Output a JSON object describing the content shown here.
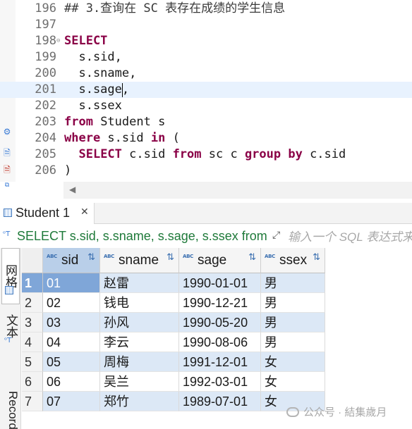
{
  "editor": {
    "lines": [
      {
        "num": "196",
        "parts": [
          {
            "t": "## 3.查询在 SC 表存在成绩的学生信息",
            "c": "cm"
          }
        ]
      },
      {
        "num": "197",
        "parts": []
      },
      {
        "num": "198",
        "fold": "⊖",
        "parts": [
          {
            "t": "SELECT",
            "c": "kw"
          }
        ]
      },
      {
        "num": "199",
        "parts": [
          {
            "t": "  s.sid,",
            "c": ""
          }
        ]
      },
      {
        "num": "200",
        "parts": [
          {
            "t": "  s.sname,",
            "c": ""
          }
        ]
      },
      {
        "num": "201",
        "current": true,
        "parts": [
          {
            "t": "  s.sage,",
            "c": ""
          }
        ]
      },
      {
        "num": "202",
        "parts": [
          {
            "t": "  s.ssex",
            "c": ""
          }
        ]
      },
      {
        "num": "203",
        "parts": [
          {
            "t": "from",
            "c": "kw"
          },
          {
            "t": " Student s",
            "c": ""
          }
        ]
      },
      {
        "num": "204",
        "parts": [
          {
            "t": "where",
            "c": "kw"
          },
          {
            "t": " s.sid ",
            "c": ""
          },
          {
            "t": "in",
            "c": "kw"
          },
          {
            "t": " (",
            "c": ""
          }
        ]
      },
      {
        "num": "205",
        "parts": [
          {
            "t": "  ",
            "c": ""
          },
          {
            "t": "SELECT",
            "c": "kw"
          },
          {
            "t": " c.sid ",
            "c": ""
          },
          {
            "t": "from",
            "c": "kw"
          },
          {
            "t": " sc c ",
            "c": ""
          },
          {
            "t": "group by",
            "c": "kw"
          },
          {
            "t": " c.sid",
            "c": ""
          }
        ]
      },
      {
        "num": "206",
        "parts": [
          {
            "t": ")",
            "c": ""
          }
        ]
      }
    ],
    "gutter_icons": [
      "gear-icon",
      "document-icon",
      "document-error-icon",
      "variables-icon"
    ]
  },
  "results": {
    "tab_label": "Student 1",
    "filter_sql": "SELECT s.sid, s.sname, s.sage, s.ssex from Student s where s.sid in ( SELECT c.sid from sc c group by c.sid )",
    "filter_placeholder": "输入一个 SQL 表达式来过滤结果",
    "side_tabs": {
      "grid": "网格",
      "text": "文本",
      "record": "Record"
    },
    "columns": [
      "sid",
      "sname",
      "sage",
      "ssex"
    ],
    "rows": [
      {
        "n": "1",
        "sid": "01",
        "sname": "赵雷",
        "sage": "1990-01-01",
        "ssex": "男"
      },
      {
        "n": "2",
        "sid": "02",
        "sname": "钱电",
        "sage": "1990-12-21",
        "ssex": "男"
      },
      {
        "n": "3",
        "sid": "03",
        "sname": "孙风",
        "sage": "1990-05-20",
        "ssex": "男"
      },
      {
        "n": "4",
        "sid": "04",
        "sname": "李云",
        "sage": "1990-08-06",
        "ssex": "男"
      },
      {
        "n": "5",
        "sid": "05",
        "sname": "周梅",
        "sage": "1991-12-01",
        "ssex": "女"
      },
      {
        "n": "6",
        "sid": "06",
        "sname": "吴兰",
        "sage": "1992-03-01",
        "ssex": "女"
      },
      {
        "n": "7",
        "sid": "07",
        "sname": "郑竹",
        "sage": "1989-07-01",
        "ssex": "女"
      }
    ],
    "selected_row": 0,
    "type_badge": "ABC"
  },
  "watermark": "公众号 · 結集歲月",
  "colors": {
    "keyword": "#8a0046",
    "filter_sql": "#1f7a3a",
    "row_stripe": "#dce8f6",
    "selection": "#7fa6d8"
  }
}
